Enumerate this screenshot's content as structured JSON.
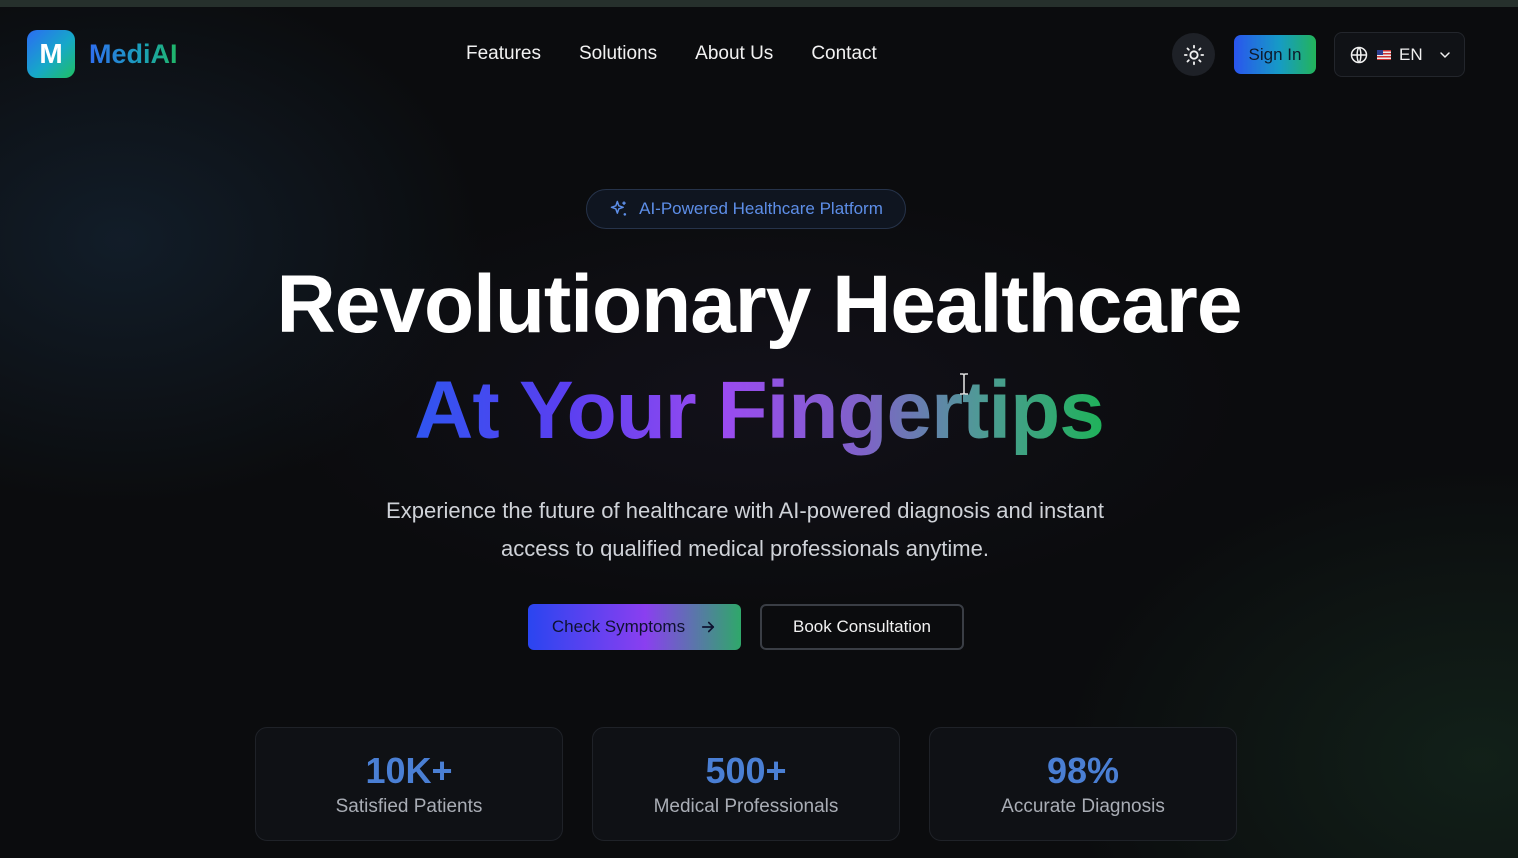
{
  "brand": {
    "logo_letter": "M",
    "name": "MediAI"
  },
  "nav": {
    "items": [
      {
        "label": "Features"
      },
      {
        "label": "Solutions"
      },
      {
        "label": "About Us"
      },
      {
        "label": "Contact"
      }
    ]
  },
  "header": {
    "theme_icon": "sun-icon",
    "sign_in_label": "Sign In",
    "language": {
      "icon": "globe-icon",
      "flag": "us-flag-icon",
      "label": "EN"
    }
  },
  "hero": {
    "badge": "AI-Powered Healthcare Platform",
    "title_line1": "Revolutionary Healthcare",
    "title_line2": "At Your Fingertips",
    "subtitle": "Experience the future of healthcare with AI-powered diagnosis and instant access to qualified medical professionals anytime.",
    "primary_cta": "Check Symptoms",
    "secondary_cta": "Book Consultation"
  },
  "stats": [
    {
      "value": "10K+",
      "label": "Satisfied Patients"
    },
    {
      "value": "500+",
      "label": "Medical Professionals"
    },
    {
      "value": "98%",
      "label": "Accurate Diagnosis"
    }
  ],
  "colors": {
    "accent_blue": "#2f6ef0",
    "accent_green": "#20b765",
    "accent_purple": "#9a4bf0",
    "background": "#0b0c0e"
  }
}
